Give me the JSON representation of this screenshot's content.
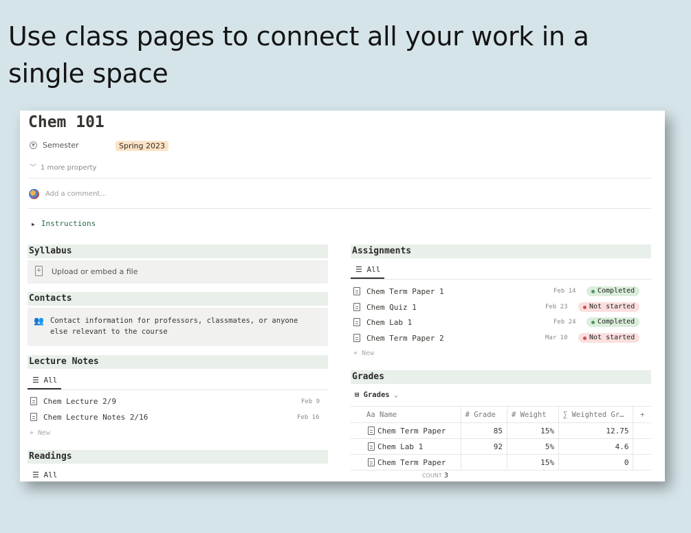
{
  "headline": "Use class pages to connect all your work in a single space",
  "page": {
    "title": "Chem 101",
    "property_label": "Semester",
    "semester_value": "Spring 2023",
    "more_property": "1 more property",
    "comment_placeholder": "Add a comment...",
    "instructions": "Instructions"
  },
  "syllabus": {
    "title": "Syllabus",
    "upload_text": "Upload or embed a file"
  },
  "contacts": {
    "title": "Contacts",
    "emoji": "👥",
    "text_line1": "Contact information for professors, classmates, or anyone",
    "text_line2": "else relevant to the course"
  },
  "lecture_notes": {
    "title": "Lecture Notes",
    "view": "All",
    "items": [
      {
        "name": "Chem Lecture 2/9",
        "date": "Feb 9"
      },
      {
        "name": "Chem Lecture Notes 2/16",
        "date": "Feb 16"
      }
    ],
    "new_label": "+ New"
  },
  "readings": {
    "title": "Readings",
    "view": "All"
  },
  "assignments": {
    "title": "Assignments",
    "view": "All",
    "items": [
      {
        "name": "Chem Term Paper 1",
        "date": "Feb 14",
        "status": "Completed"
      },
      {
        "name": "Chem Quiz 1",
        "date": "Feb 23",
        "status": "Not started"
      },
      {
        "name": "Chem Lab 1",
        "date": "Feb 24",
        "status": "Completed"
      },
      {
        "name": "Chem Term Paper 2",
        "date": "Mar 10",
        "status": "Not started"
      }
    ],
    "new_label": "+ New"
  },
  "grades": {
    "title": "Grades",
    "view": "Grades",
    "columns": [
      "Aa Name",
      "# Grade",
      "# Weight",
      "∑ Weighted Gr…",
      "+"
    ],
    "rows": [
      {
        "name": "Chem Term Paper",
        "grade": "85",
        "weight": "15%",
        "weighted": "12.75"
      },
      {
        "name": "Chem Lab 1",
        "grade": "92",
        "weight": "5%",
        "weighted": "4.6"
      },
      {
        "name": "Chem Term Paper",
        "grade": "",
        "weight": "15%",
        "weighted": "0"
      }
    ],
    "count_label": "COUNT",
    "count_value": "3"
  },
  "colors": {
    "background": "#d5e4e9",
    "section_header": "#e9efe9",
    "completed": "#dbeddb",
    "not_started": "#fbdede",
    "semester_tag": "#fae3c8"
  }
}
